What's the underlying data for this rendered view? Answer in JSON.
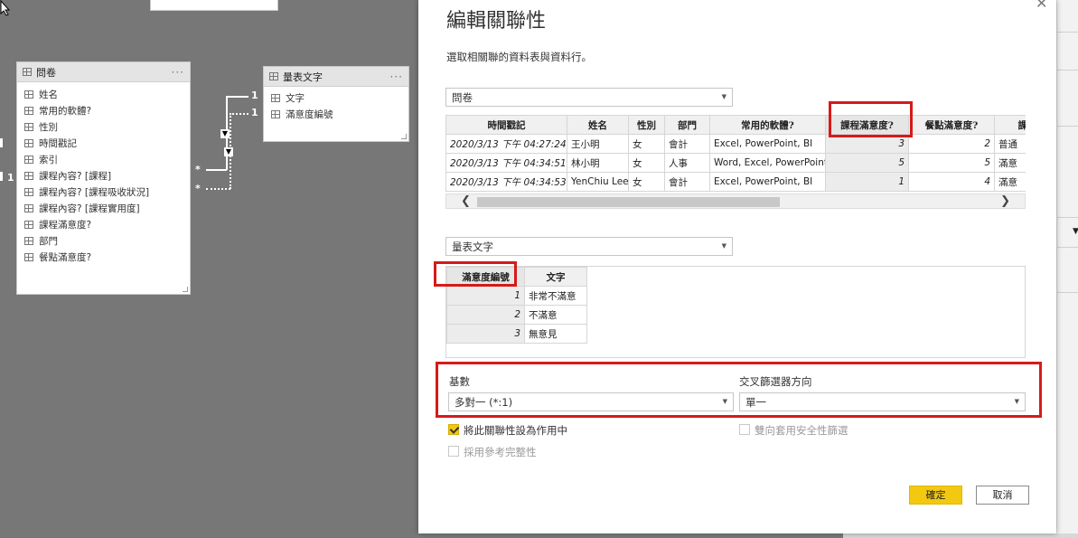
{
  "canvas": {
    "tables": [
      {
        "id": "wenjuan",
        "title": "問卷",
        "fields": [
          "姓名",
          "常用的軟體?",
          "性別",
          "時間戳記",
          "索引",
          "課程內容? [課程]",
          "課程內容? [課程吸收狀況]",
          "課程內容? [課程實用度]",
          "課程滿意度?",
          "部門",
          "餐點滿意度?"
        ]
      },
      {
        "id": "liangbiao",
        "title": "量表文字",
        "fields": [
          "文字",
          "滿意度編號"
        ]
      }
    ],
    "rel_labels": [
      "1",
      "1",
      "1"
    ],
    "many_marks": [
      "*",
      "*"
    ],
    "more_icon": "···"
  },
  "dialog": {
    "title": "編輯關聯性",
    "subtitle": "選取相關聯的資料表與資料行。",
    "close_icon": "close-icon",
    "table1": {
      "selected": "問卷",
      "columns": [
        "時間戳記",
        "姓名",
        "性別",
        "部門",
        "常用的軟體?",
        "課程滿意度?",
        "餐點滿意度?",
        "課程"
      ],
      "rows": [
        [
          "2020/3/13 下午 04:27:24",
          "王小明",
          "女",
          "會計",
          "Excel, PowerPoint, BI",
          "3",
          "2",
          "普通"
        ],
        [
          "2020/3/13 下午 04:34:51",
          "林小明",
          "女",
          "人事",
          "Word, Excel, PowerPoint",
          "5",
          "5",
          "滿意"
        ],
        [
          "2020/3/13 下午 04:34:53",
          "YenChiu Lee",
          "女",
          "會計",
          "Excel, PowerPoint, BI",
          "1",
          "4",
          "滿意"
        ]
      ]
    },
    "table2": {
      "selected": "量表文字",
      "columns": [
        "滿意度編號",
        "文字"
      ],
      "rows": [
        [
          "1",
          "非常不滿意"
        ],
        [
          "2",
          "不滿意"
        ],
        [
          "3",
          "無意見"
        ]
      ]
    },
    "cardinality": {
      "label": "基數",
      "value": "多對一 (*:1)"
    },
    "crossfilter": {
      "label": "交叉篩選器方向",
      "value": "單一"
    },
    "options": {
      "active": {
        "label": "將此關聯性設為作用中",
        "checked": true
      },
      "bidir_security": {
        "label": "雙向套用安全性篩選",
        "checked": false,
        "disabled": true
      },
      "ref_integrity": {
        "label": "採用參考完整性",
        "checked": false,
        "disabled": true
      }
    },
    "ok_label": "確定",
    "cancel_label": "取消",
    "accent": "#f2c811",
    "highlight": "#d61a1a"
  }
}
